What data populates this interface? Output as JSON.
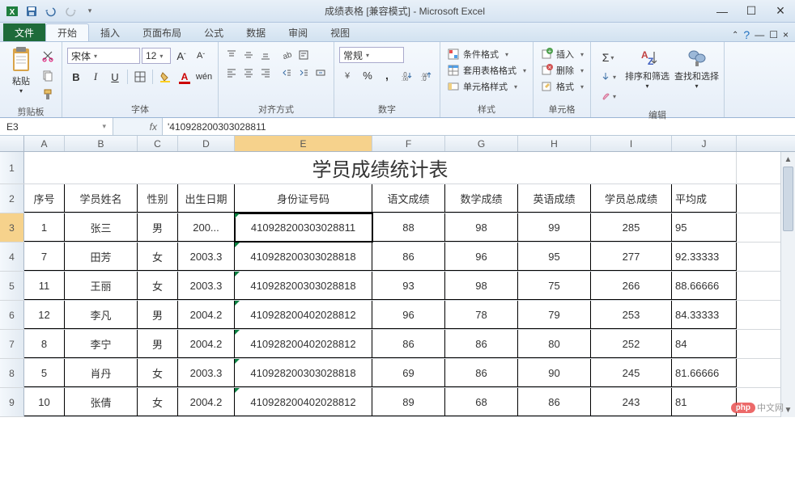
{
  "window": {
    "title": "成绩表格 [兼容模式] - Microsoft Excel",
    "min": "—",
    "max": "☐",
    "close": "×"
  },
  "tabs": {
    "file": "文件",
    "home": "开始",
    "insert": "插入",
    "layout": "页面布局",
    "formulas": "公式",
    "data": "数据",
    "review": "审阅",
    "view": "视图"
  },
  "ribbon": {
    "clipboard": {
      "paste": "粘贴",
      "label": "剪贴板"
    },
    "font": {
      "name": "宋体",
      "size": "12",
      "label": "字体",
      "bold": "B",
      "italic": "I",
      "underline": "U",
      "big_a": "A",
      "small_a": "A"
    },
    "alignment": {
      "label": "对齐方式"
    },
    "number": {
      "format": "常规",
      "label": "数字"
    },
    "styles": {
      "cond": "条件格式",
      "table": "套用表格格式",
      "cell": "单元格样式",
      "label": "样式"
    },
    "cells": {
      "insert": "插入",
      "delete": "删除",
      "format": "格式",
      "label": "单元格"
    },
    "editing": {
      "sigma": "Σ",
      "sort": "排序和筛选",
      "find": "查找和选择",
      "label": "编辑"
    }
  },
  "namebox": "E3",
  "formula": "'410928200303028811",
  "columns": [
    "A",
    "B",
    "C",
    "D",
    "E",
    "F",
    "G",
    "H",
    "I",
    "J"
  ],
  "sheet_title": "学员成绩统计表",
  "headers": [
    "序号",
    "学员姓名",
    "性别",
    "出生日期",
    "身份证号码",
    "语文成绩",
    "数学成绩",
    "英语成绩",
    "学员总成绩",
    "平均成"
  ],
  "rows": [
    {
      "rn": "3",
      "A": "1",
      "B": "张三",
      "C": "男",
      "D": "200...",
      "E": "410928200303028811",
      "F": "88",
      "G": "98",
      "H": "99",
      "I": "285",
      "J": "95",
      "sel": true
    },
    {
      "rn": "4",
      "A": "7",
      "B": "田芳",
      "C": "女",
      "D": "2003.3",
      "E": "410928200303028818",
      "F": "86",
      "G": "96",
      "H": "95",
      "I": "277",
      "J": "92.33333"
    },
    {
      "rn": "5",
      "A": "11",
      "B": "王丽",
      "C": "女",
      "D": "2003.3",
      "E": "410928200303028818",
      "F": "93",
      "G": "98",
      "H": "75",
      "I": "266",
      "J": "88.66666"
    },
    {
      "rn": "6",
      "A": "12",
      "B": "李凡",
      "C": "男",
      "D": "2004.2",
      "E": "410928200402028812",
      "F": "96",
      "G": "78",
      "H": "79",
      "I": "253",
      "J": "84.33333"
    },
    {
      "rn": "7",
      "A": "8",
      "B": "李宁",
      "C": "男",
      "D": "2004.2",
      "E": "410928200402028812",
      "F": "86",
      "G": "86",
      "H": "80",
      "I": "252",
      "J": "84"
    },
    {
      "rn": "8",
      "A": "5",
      "B": "肖丹",
      "C": "女",
      "D": "2003.3",
      "E": "410928200303028818",
      "F": "69",
      "G": "86",
      "H": "90",
      "I": "245",
      "J": "81.66666"
    },
    {
      "rn": "9",
      "A": "10",
      "B": "张倩",
      "C": "女",
      "D": "2004.2",
      "E": "410928200402028812",
      "F": "89",
      "G": "68",
      "H": "86",
      "I": "243",
      "J": "81"
    }
  ],
  "row_nums_pre": [
    "1",
    "2"
  ],
  "watermark": {
    "badge": "php",
    "text": "中文网"
  },
  "error_hint": "◆!"
}
